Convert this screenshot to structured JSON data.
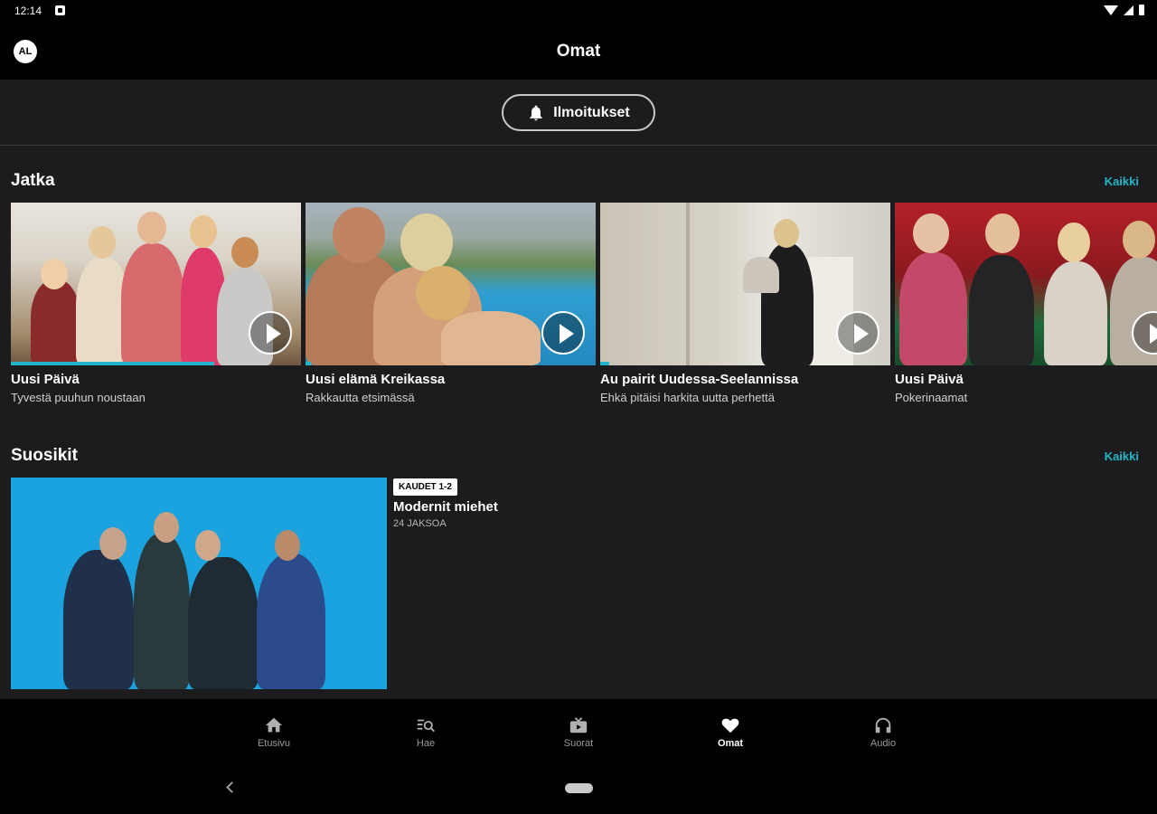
{
  "status": {
    "time": "12:14"
  },
  "header": {
    "title": "Omat",
    "avatar_initials": "AL"
  },
  "notifications": {
    "label": "Ilmoitukset"
  },
  "continue": {
    "title": "Jatka",
    "see_all": "Kaikki",
    "items": [
      {
        "title": "Uusi Päivä",
        "subtitle": "Tyvestä puuhun noustaan",
        "progress": 0.7
      },
      {
        "title": "Uusi elämä Kreikassa",
        "subtitle": "Rakkautta etsimässä",
        "progress": 0.02
      },
      {
        "title": "Au pairit Uudessa-Seelannissa",
        "subtitle": "Ehkä pitäisi harkita uutta perhettä",
        "progress": 0.03
      },
      {
        "title": "Uusi Päivä",
        "subtitle": "Pokerinaamat",
        "progress": 0
      }
    ]
  },
  "favorites": {
    "title": "Suosikit",
    "see_all": "Kaikki",
    "items": [
      {
        "badge": "KAUDET 1-2",
        "title": "Modernit miehet",
        "meta": "24 JAKSOA"
      }
    ]
  },
  "bottom_nav": {
    "items": [
      {
        "label": "Etusivu",
        "icon": "home-icon"
      },
      {
        "label": "Hae",
        "icon": "search-list-icon"
      },
      {
        "label": "Suorat",
        "icon": "live-tv-icon"
      },
      {
        "label": "Omat",
        "icon": "heart-icon",
        "active": true
      },
      {
        "label": "Audio",
        "icon": "headphones-icon"
      }
    ]
  },
  "colors": {
    "accent": "#22b5c9",
    "background": "#1c1c1e",
    "bar": "#000000"
  }
}
